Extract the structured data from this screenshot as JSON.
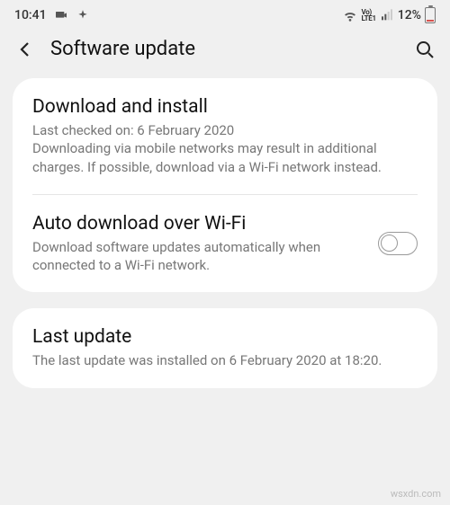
{
  "status_bar": {
    "time": "10:41",
    "battery_pct": "12%",
    "volte_label": "VoLTE1"
  },
  "header": {
    "title": "Software update"
  },
  "download_install": {
    "title": "Download and install",
    "last_checked": "Last checked on: 6 February 2020",
    "desc": "Downloading via mobile networks may result in additional charges. If possible, download via a Wi-Fi network instead."
  },
  "auto_download": {
    "title": "Auto download over Wi-Fi",
    "desc": "Download software updates automatically when connected to a Wi-Fi network.",
    "enabled": false
  },
  "last_update": {
    "title": "Last update",
    "desc": "The last update was installed on 6 February 2020 at 18:20."
  },
  "watermark": "wsxdn.com"
}
